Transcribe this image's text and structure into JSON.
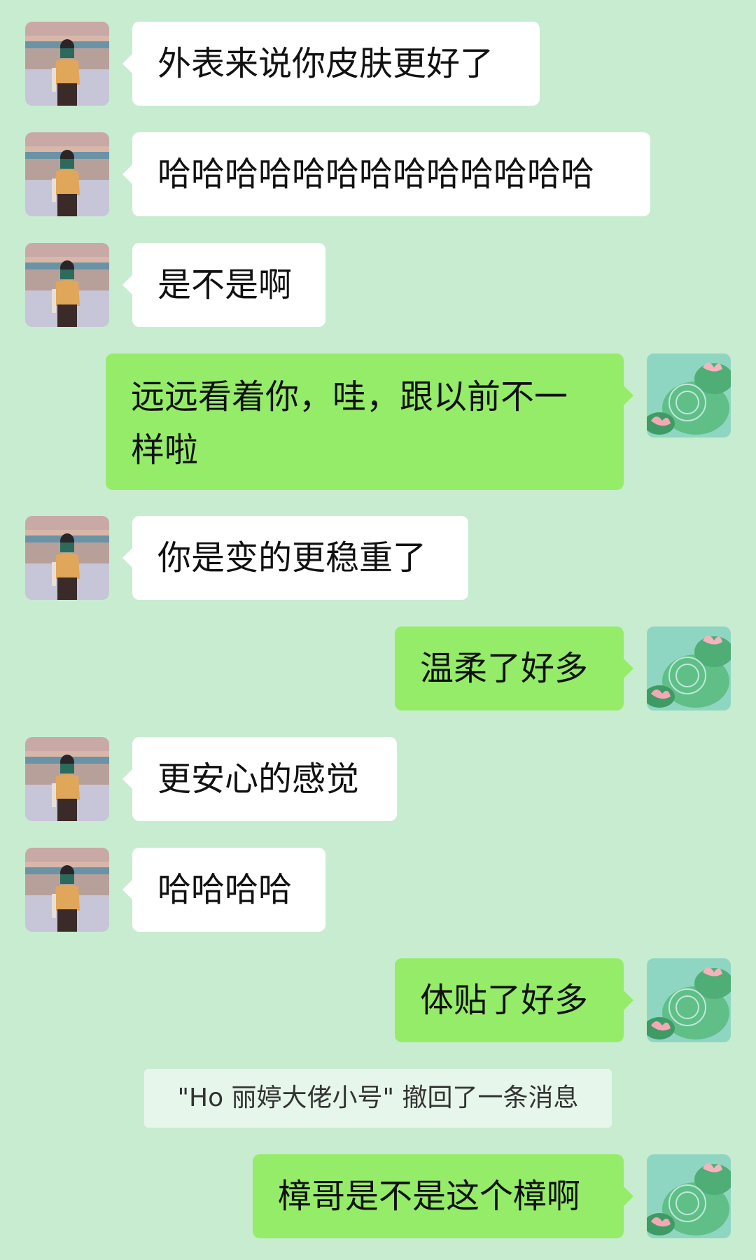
{
  "colors": {
    "background": "#c8ecd0",
    "incoming_bubble": "#ffffff",
    "outgoing_bubble": "#95ec69"
  },
  "icons": {
    "contact_avatar": "avatar-girl-beach-icon",
    "self_avatar": "avatar-lotus-pond-icon"
  },
  "messages": [
    {
      "sender": "contact",
      "text": "外表来说你皮肤更好了"
    },
    {
      "sender": "contact",
      "text": "哈哈哈哈哈哈哈哈哈哈哈哈哈"
    },
    {
      "sender": "contact",
      "text": "是不是啊"
    },
    {
      "sender": "self",
      "text": "远远看着你，哇，跟以前不一样啦"
    },
    {
      "sender": "contact",
      "text": "你是变的更稳重了"
    },
    {
      "sender": "self",
      "text": "温柔了好多"
    },
    {
      "sender": "contact",
      "text": "更安心的感觉"
    },
    {
      "sender": "contact",
      "text": "哈哈哈哈"
    },
    {
      "sender": "self",
      "text": "体贴了好多"
    },
    {
      "sender": "system",
      "text": "\"Ho 丽婷大佬小号\" 撤回了一条消息"
    },
    {
      "sender": "self",
      "text": "樟哥是不是这个樟啊"
    }
  ]
}
